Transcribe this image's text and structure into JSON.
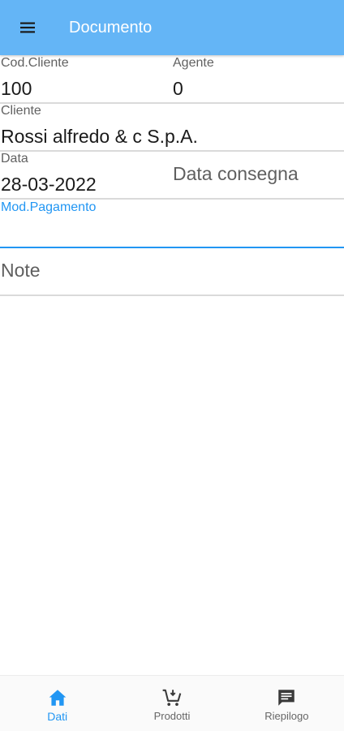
{
  "appbar": {
    "title": "Documento",
    "menu_icon": "menu-icon"
  },
  "form": {
    "cod_cliente": {
      "label": "Cod.Cliente",
      "value": "100"
    },
    "agente": {
      "label": "Agente",
      "value": "0"
    },
    "cliente": {
      "label": "Cliente",
      "value": "Rossi alfredo & c S.p.A."
    },
    "data": {
      "label": "Data",
      "value": "28-03-2022"
    },
    "data_consegna": {
      "placeholder": "Data consegna"
    },
    "mod_pagamento": {
      "label": "Mod.Pagamento",
      "value": ""
    },
    "note": {
      "placeholder": "Note"
    }
  },
  "colors": {
    "appbar": "#64b5f6",
    "accent": "#2196f3"
  },
  "bottom_nav": {
    "items": [
      {
        "label": "Dati",
        "icon": "home-icon",
        "active": true
      },
      {
        "label": "Prodotti",
        "icon": "cart-icon",
        "active": false
      },
      {
        "label": "Riepilogo",
        "icon": "message-icon",
        "active": false
      }
    ]
  }
}
